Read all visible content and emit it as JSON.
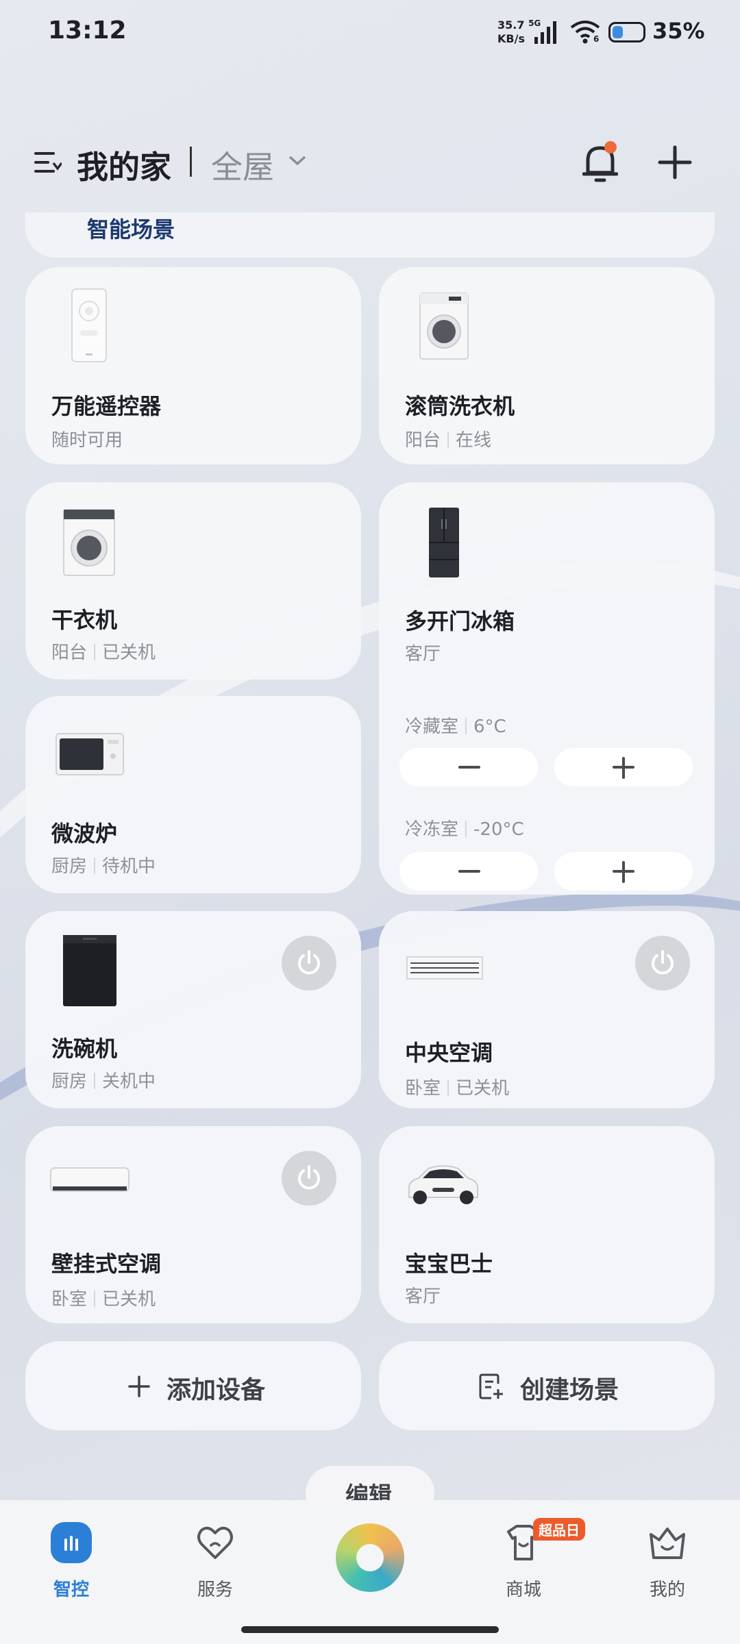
{
  "status_bar": {
    "time": "13:12",
    "net_speed_value": "35.7",
    "net_speed_unit": "KB/s",
    "net_type": "5G",
    "wifi_level": "6",
    "battery_percent": "35%",
    "battery_level": 0.35
  },
  "header": {
    "home_name": "我的家",
    "room_filter": "全屋"
  },
  "scene_strip_text": "智能场景",
  "devices": [
    {
      "name": "万能遥控器",
      "room": "",
      "status": "随时可用"
    },
    {
      "name": "滚筒洗衣机",
      "room": "阳台",
      "status": "在线"
    },
    {
      "name": "干衣机",
      "room": "阳台",
      "status": "已关机"
    },
    {
      "name": "多开门冰箱",
      "room": "客厅",
      "status": ""
    },
    {
      "name": "微波炉",
      "room": "厨房",
      "status": "待机中"
    },
    {
      "name": "洗碗机",
      "room": "厨房",
      "status": "关机中"
    },
    {
      "name": "中央空调",
      "room": "卧室",
      "status": "已关机"
    },
    {
      "name": "壁挂式空调",
      "room": "卧室",
      "status": "已关机"
    },
    {
      "name": "宝宝巴士",
      "room": "客厅",
      "status": ""
    }
  ],
  "fridge": {
    "fridge_label": "冷藏室",
    "fridge_temp": "6°C",
    "freezer_label": "冷冻室",
    "freezer_temp": "-20°C"
  },
  "actions": {
    "add_device": "添加设备",
    "create_scene": "创建场景",
    "edit": "编辑"
  },
  "bottom_nav": [
    {
      "label": "智控",
      "icon": "smart-control-icon",
      "active": true
    },
    {
      "label": "服务",
      "icon": "heart-icon",
      "active": false
    },
    {
      "label": "",
      "icon": "assistant-orb-icon",
      "active": false
    },
    {
      "label": "商城",
      "icon": "shop-icon",
      "active": false,
      "badge": "超品日"
    },
    {
      "label": "我的",
      "icon": "profile-icon",
      "active": false
    }
  ],
  "colors": {
    "accent": "#2c7fd6",
    "badge": "#ee5a2a",
    "notification_dot": "#ee6a3a"
  }
}
